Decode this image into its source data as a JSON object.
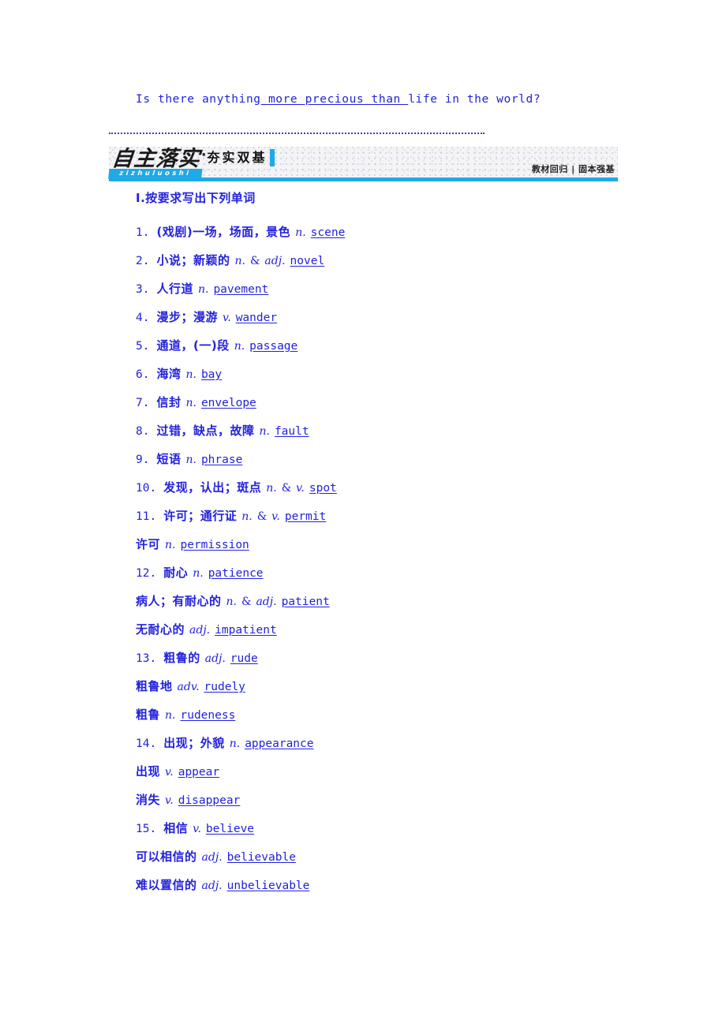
{
  "top_sentence": {
    "before": "Is there anything",
    "blank": " more precious than ",
    "after": "life in the world?"
  },
  "divider": {
    "style": "dotted-blue-rule"
  },
  "banner": {
    "cn_title": "自主落实",
    "pinyin": "zizhuluoshi",
    "separator_dot": "·",
    "subtitle": "夯实双基",
    "right_label": "教材回归 | 固本强基",
    "accent_color": "#1fa9e6"
  },
  "question_heading": "Ⅰ.按要求写出下列单词",
  "vocab_items": [
    {
      "num": "1.",
      "cn": "(戏剧)一场，场面，景色",
      "pos": "n.",
      "amp": "",
      "pos2": "",
      "answer": "scene"
    },
    {
      "num": "2.",
      "cn": "小说；新颖的",
      "pos": "n.",
      "amp": "&",
      "pos2": "adj.",
      "answer": "novel"
    },
    {
      "num": "3.",
      "cn": "人行道",
      "pos": "n.",
      "amp": "",
      "pos2": "",
      "answer": "pavement"
    },
    {
      "num": "4.",
      "cn": "漫步；漫游",
      "pos": "v.",
      "amp": "",
      "pos2": "",
      "answer": "wander"
    },
    {
      "num": "5.",
      "cn": "通道，(一)段",
      "pos": "n.",
      "amp": "",
      "pos2": "",
      "answer": "passage"
    },
    {
      "num": "6.",
      "cn": "海湾",
      "pos": "n.",
      "amp": "",
      "pos2": "",
      "answer": "bay"
    },
    {
      "num": "7.",
      "cn": "信封",
      "pos": "n.",
      "amp": "",
      "pos2": "",
      "answer": "envelope"
    },
    {
      "num": "8.",
      "cn": "过错，缺点，故障",
      "pos": "n.",
      "amp": "",
      "pos2": "",
      "answer": "fault"
    },
    {
      "num": "9.",
      "cn": "短语",
      "pos": "n.",
      "amp": "",
      "pos2": "",
      "answer": "phrase"
    },
    {
      "num": "10.",
      "cn": "发现，认出；斑点",
      "pos": "n.",
      "amp": "&",
      "pos2": "v.",
      "answer": "spot"
    },
    {
      "num": "11.",
      "cn": "许可；通行证",
      "pos": "n.",
      "amp": "&",
      "pos2": "v.",
      "answer": "permit"
    },
    {
      "num": "",
      "cn": "许可",
      "pos": "n.",
      "amp": "",
      "pos2": "",
      "answer": "permission"
    },
    {
      "num": "12.",
      "cn": "耐心",
      "pos": "n.",
      "amp": "",
      "pos2": "",
      "answer": "patience"
    },
    {
      "num": "",
      "cn": "病人；有耐心的",
      "pos": "n.",
      "amp": "&",
      "pos2": "adj.",
      "answer": "patient"
    },
    {
      "num": "",
      "cn": "无耐心的",
      "pos": "adj.",
      "amp": "",
      "pos2": "",
      "answer": "impatient"
    },
    {
      "num": "13.",
      "cn": "粗鲁的",
      "pos": "adj.",
      "amp": "",
      "pos2": "",
      "answer": "rude"
    },
    {
      "num": "",
      "cn": "粗鲁地",
      "pos": "adv.",
      "amp": "",
      "pos2": "",
      "answer": "rudely"
    },
    {
      "num": "",
      "cn": "粗鲁",
      "pos": "n.",
      "amp": "",
      "pos2": "",
      "answer": "rudeness"
    },
    {
      "num": "14.",
      "cn": "出现；外貌",
      "pos": "n.",
      "amp": "",
      "pos2": "",
      "answer": "appearance"
    },
    {
      "num": "",
      "cn": "出现",
      "pos": "v.",
      "amp": "",
      "pos2": "",
      "answer": "appear"
    },
    {
      "num": "",
      "cn": "消失",
      "pos": "v.",
      "amp": "",
      "pos2": "",
      "answer": "disappear"
    },
    {
      "num": "15.",
      "cn": "相信",
      "pos": "v.",
      "amp": "",
      "pos2": "",
      "answer": "believe"
    },
    {
      "num": "",
      "cn": "可以相信的",
      "pos": "adj.",
      "amp": "",
      "pos2": "",
      "answer": "believable"
    },
    {
      "num": "",
      "cn": "难以置信的",
      "pos": "adj.",
      "amp": "",
      "pos2": "",
      "answer": "unbelievable"
    }
  ]
}
